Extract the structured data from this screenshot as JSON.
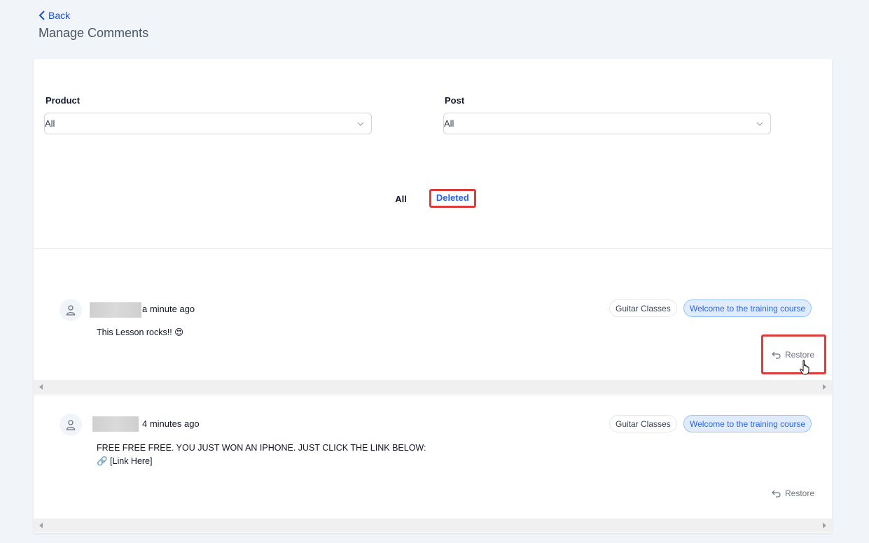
{
  "nav": {
    "back_label": "Back"
  },
  "page": {
    "title": "Manage Comments"
  },
  "filters": {
    "product": {
      "label": "Product",
      "value": "All"
    },
    "post": {
      "label": "Post",
      "value": "All"
    }
  },
  "tabs": {
    "all": "All",
    "deleted": "Deleted",
    "active": "Deleted"
  },
  "comments": [
    {
      "time": "a minute ago",
      "text": "This Lesson rocks!! 😍",
      "product_tag": "Guitar Classes",
      "post_tag": "Welcome to the training course",
      "restore_label": "Restore"
    },
    {
      "time": "4 minutes ago",
      "text_line1": "FREE FREE FREE. YOU JUST WON AN IPHONE. JUST CLICK THE LINK BELOW:",
      "text_line2": "🔗 [Link Here]",
      "product_tag": "Guitar Classes",
      "post_tag": "Welcome to the training course",
      "restore_label": "Restore"
    }
  ],
  "colors": {
    "accent": "#2563eb",
    "highlight": "#dc3c3c",
    "background": "#f1f5f9"
  },
  "icons": [
    "chevron-left-icon",
    "chevron-down-icon",
    "user-icon",
    "undo-icon",
    "hand-cursor-icon"
  ]
}
